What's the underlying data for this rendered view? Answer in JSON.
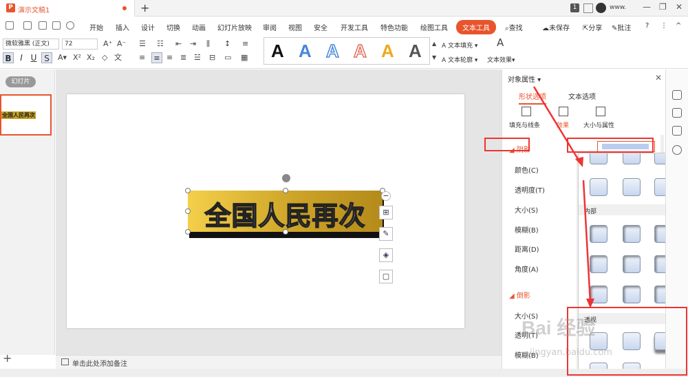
{
  "titlebar": {
    "doc_title": "演示文稿1",
    "logo": "P",
    "new_tab": "+",
    "page_badge": "1",
    "username": "www.",
    "win_min": "—",
    "win_restore": "❐",
    "win_close": "✕"
  },
  "menu": {
    "items": [
      "开始",
      "插入",
      "设计",
      "切换",
      "动画",
      "幻灯片放映",
      "审阅",
      "视图",
      "安全",
      "开发工具",
      "特色功能",
      "绘图工具"
    ],
    "active": "文本工具",
    "search": "查找",
    "unsaved": "未保存",
    "share": "分享",
    "comment": "批注",
    "help": "?",
    "more": "⋮",
    "collapse": "^"
  },
  "ribbon": {
    "font_name": "微软雅黑 (正文)",
    "font_size": "72",
    "bold": "B",
    "italic": "I",
    "underline": "U",
    "strike": "S",
    "text_fill": "文本填充",
    "text_outline": "文本轮廓",
    "text_effect": "文本效果",
    "style_letters": [
      "A",
      "A",
      "A",
      "A",
      "A",
      "A"
    ],
    "style_colors": [
      "#111111",
      "#4a86d8",
      "#4a86d8",
      "#e07060",
      "#f0a820",
      "#555555"
    ]
  },
  "left_panel": {
    "tab": "幻灯片",
    "thumb_text": "全国人民再次",
    "add": "+"
  },
  "slide": {
    "text": "全国人民再次"
  },
  "notes": {
    "placeholder": "单击此处添加备注"
  },
  "property_pane": {
    "title": "对象属性",
    "close": "✕",
    "tabs": [
      "形状选项",
      "文本选项"
    ],
    "subtabs": [
      "填充与线条",
      "效果",
      "大小与属性"
    ],
    "shadow_section": "阴影",
    "shadow_props": [
      "颜色(C)",
      "透明度(T)",
      "大小(S)",
      "模糊(B)",
      "距离(D)",
      "角度(A)"
    ],
    "reflection_section": "倒影",
    "reflection_props": [
      "大小(S)",
      "透明(T)",
      "模糊(B)"
    ]
  },
  "popup": {
    "inner_label": "内部",
    "perspective_label": "透视"
  },
  "watermark": {
    "brand": "Bai 经验",
    "url": "jingyan.baidu.com"
  },
  "colors": {
    "accent": "#e8552d",
    "annotation": "#ee3333"
  }
}
